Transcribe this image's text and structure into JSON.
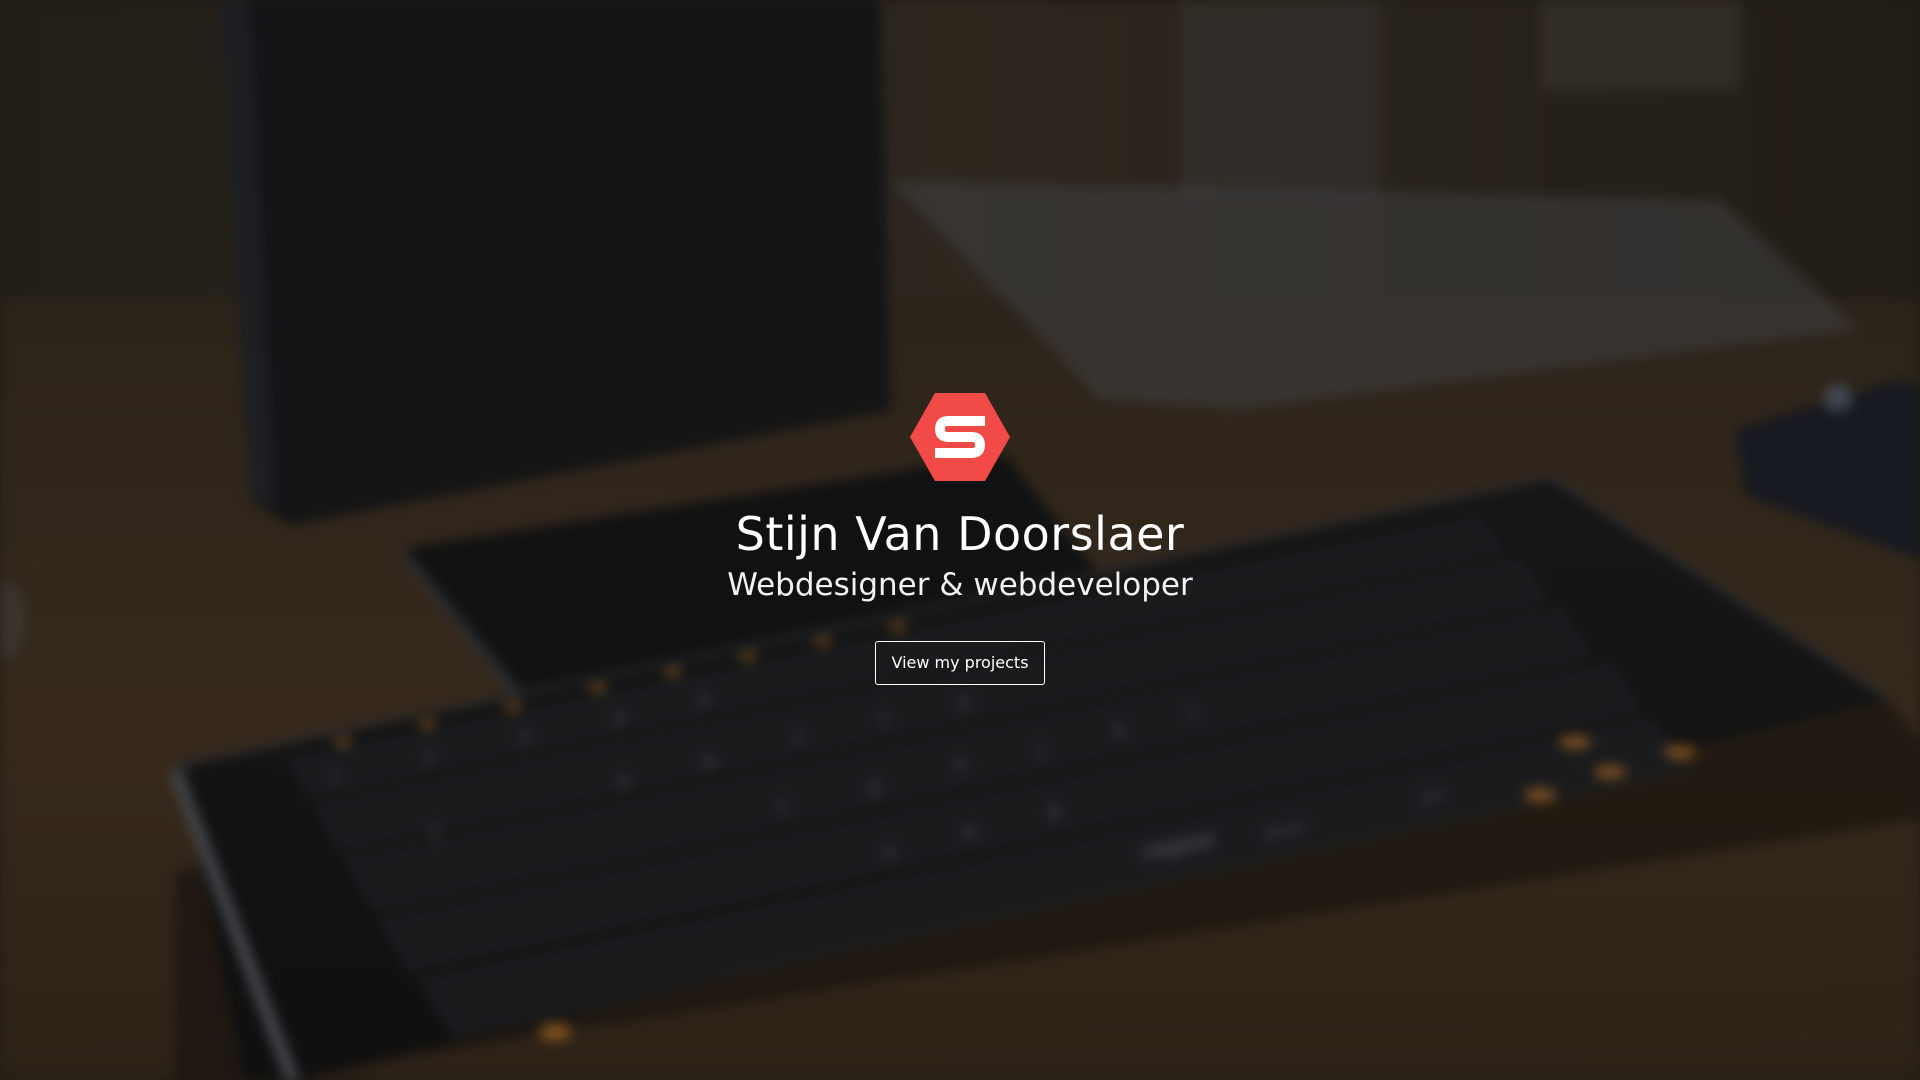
{
  "hero": {
    "name": "Stijn Van Doorslaer",
    "tagline": "Webdesigner & webdeveloper",
    "cta_label": "View my projects",
    "background_image": "blurred-desk-keyboard-photo"
  },
  "logo": {
    "icon": "hexagon-s-logo-icon",
    "letter": "S",
    "color": "#f24a46"
  },
  "keyboard": {
    "brand": "rapoo",
    "row_fn": [
      "Esc",
      "F1",
      "F2",
      "F3",
      "F4",
      "F5",
      "F6",
      "F7"
    ],
    "row_num": [
      "1",
      "2",
      "3",
      "4",
      "5",
      "6",
      "7"
    ],
    "row_top": [
      "Q",
      "W",
      "E",
      "R",
      "T",
      "Y",
      "U"
    ],
    "row_home": [
      "A",
      "S",
      "D",
      "F",
      "G",
      "H",
      "J",
      "K",
      "L"
    ],
    "row_bottom": [
      "Z",
      "X",
      "C",
      "V",
      "B",
      "N",
      "M"
    ],
    "mods": [
      "Alt Gr",
      "Ctrl"
    ]
  },
  "colors": {
    "overlay": "#12100e",
    "accent_key": "#e0892c"
  }
}
